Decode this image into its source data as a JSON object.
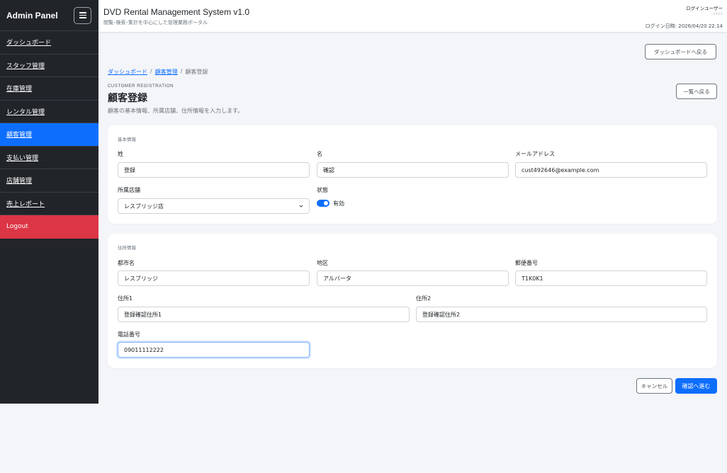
{
  "sidebar": {
    "brand": "Admin Panel",
    "items": [
      {
        "label": "ダッシュボード"
      },
      {
        "label": "スタッフ管理"
      },
      {
        "label": "在庫管理"
      },
      {
        "label": "レンタル管理"
      },
      {
        "label": "顧客管理",
        "active": true
      },
      {
        "label": "支払い管理"
      },
      {
        "label": "店舗管理"
      },
      {
        "label": "売上レポート"
      }
    ],
    "logout": "Logout"
  },
  "header": {
    "title": "DVD Rental Management System v1.0",
    "subtitle": "閲覧･検索･集計を中心にした管理業務ポータル",
    "user_label": "ログインユーザー",
    "user_name": "xxxx",
    "login_time": "ログイン日時: 2026/04/20 22:14"
  },
  "main": {
    "back_to_dashboard": "ダッシュボードへ戻る",
    "breadcrumb": [
      "ダッシュボード",
      "顧客管理",
      "顧客登録"
    ],
    "eyebrow": "CUSTOMER REGISTRATION",
    "title": "顧客登録",
    "description": "顧客の基本情報、所属店舗、住所情報を入力します。",
    "back_to_list": "一覧へ戻る",
    "basic": {
      "section_title": "基本情報",
      "last_name_label": "姓",
      "last_name_value": "登録",
      "first_name_label": "名",
      "first_name_value": "確認",
      "email_label": "メールアドレス",
      "email_value": "cust492646@example.com",
      "store_label": "所属店舗",
      "store_value": "レスブリッジ店",
      "status_label": "状態",
      "status_value": "有効",
      "status_on": true
    },
    "address": {
      "section_title": "住所情報",
      "city_label": "都市名",
      "city_value": "レスブリッジ",
      "district_label": "地区",
      "district_value": "アルバータ",
      "postal_label": "郵便番号",
      "postal_value": "T1K0K1",
      "address1_label": "住所1",
      "address1_value": "登録確認住所1",
      "address2_label": "住所2",
      "address2_value": "登録確認住所2",
      "phone_label": "電話番号",
      "phone_value": "09011112222"
    },
    "cancel": "キャンセル",
    "submit": "確認へ進む"
  },
  "colors": {
    "primary": "#0d6efd",
    "danger": "#dc3545",
    "sidebar": "#212529"
  }
}
